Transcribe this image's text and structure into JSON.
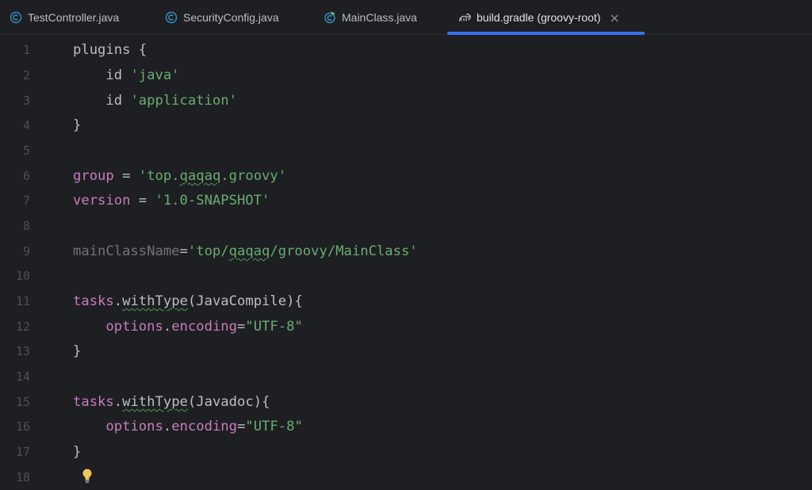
{
  "tabs": [
    {
      "label": "TestController.java",
      "icon": "class-icon",
      "active": false
    },
    {
      "label": "SecurityConfig.java",
      "icon": "class-icon",
      "active": false
    },
    {
      "label": "MainClass.java",
      "icon": "main-class-icon",
      "active": false
    },
    {
      "label": "build.gradle (groovy-root)",
      "icon": "gradle-icon",
      "active": true
    }
  ],
  "colors": {
    "background": "#1e1f22",
    "active_tab_underline": "#3574f0",
    "string": "#6aab73",
    "property": "#c77dbb",
    "line_number": "#4b5059",
    "class_icon": "#3592c4",
    "bulb": "#f2c55c"
  },
  "line_numbers": [
    "1",
    "2",
    "3",
    "4",
    "5",
    "6",
    "7",
    "8",
    "9",
    "10",
    "11",
    "12",
    "13",
    "14",
    "15",
    "16",
    "17",
    "18"
  ],
  "code": {
    "l1": {
      "a": "plugins {"
    },
    "l2": {
      "a": "    id ",
      "b": "'java'"
    },
    "l3": {
      "a": "    id ",
      "b": "'application'"
    },
    "l4": {
      "a": "}"
    },
    "l6": {
      "a": "group",
      "b": " = ",
      "c": "'top.",
      "d": "qaqaq",
      "e": ".groovy'"
    },
    "l7": {
      "a": "version",
      "b": " = ",
      "c": "'1.0-SNAPSHOT'"
    },
    "l9": {
      "a": "mainClassName",
      "b": "=",
      "c": "'top/",
      "d": "qaqaq",
      "e": "/groovy/MainClass'"
    },
    "l11": {
      "a": "tasks",
      "b": ".",
      "c": "withType",
      "d": "(JavaCompile){"
    },
    "l12": {
      "a": "    ",
      "b": "options",
      "c": ".",
      "d": "encoding",
      "e": "=",
      "f": "\"UTF-8\""
    },
    "l13": {
      "a": "}"
    },
    "l15": {
      "a": "tasks",
      "b": ".",
      "c": "withType",
      "d": "(Javadoc){"
    },
    "l16": {
      "a": "    ",
      "b": "options",
      "c": ".",
      "d": "encoding",
      "e": "=",
      "f": "\"UTF-8\""
    },
    "l17": {
      "a": "}"
    }
  }
}
